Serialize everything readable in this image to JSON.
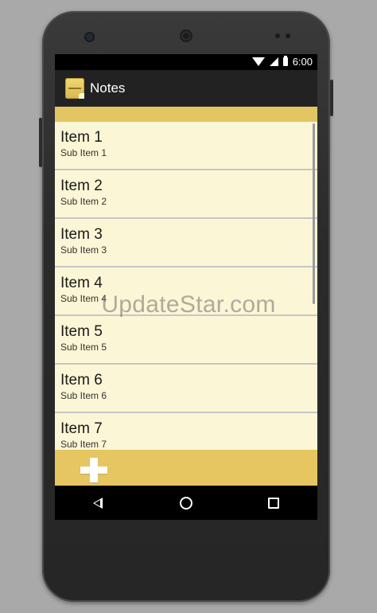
{
  "status_bar": {
    "time": "6:00"
  },
  "action_bar": {
    "title": "Notes",
    "app_icon": "notepad-icon"
  },
  "list": {
    "items": [
      {
        "title": "Item 1",
        "subtitle": "Sub Item 1"
      },
      {
        "title": "Item 2",
        "subtitle": "Sub Item 2"
      },
      {
        "title": "Item 3",
        "subtitle": "Sub Item 3"
      },
      {
        "title": "Item 4",
        "subtitle": "Sub Item 4"
      },
      {
        "title": "Item 5",
        "subtitle": "Sub Item 5"
      },
      {
        "title": "Item 6",
        "subtitle": "Sub Item 6"
      },
      {
        "title": "Item 7",
        "subtitle": "Sub Item 7"
      }
    ]
  },
  "bottom_bar": {
    "add_icon": "plus-icon"
  },
  "nav": {
    "back": "back-icon",
    "home": "home-icon",
    "recent": "recent-apps-icon"
  },
  "watermark": "UpdateStar.com",
  "colors": {
    "list_background": "#fbf6d5",
    "accent_yellow": "#e6c661",
    "action_bar": "#222222"
  }
}
